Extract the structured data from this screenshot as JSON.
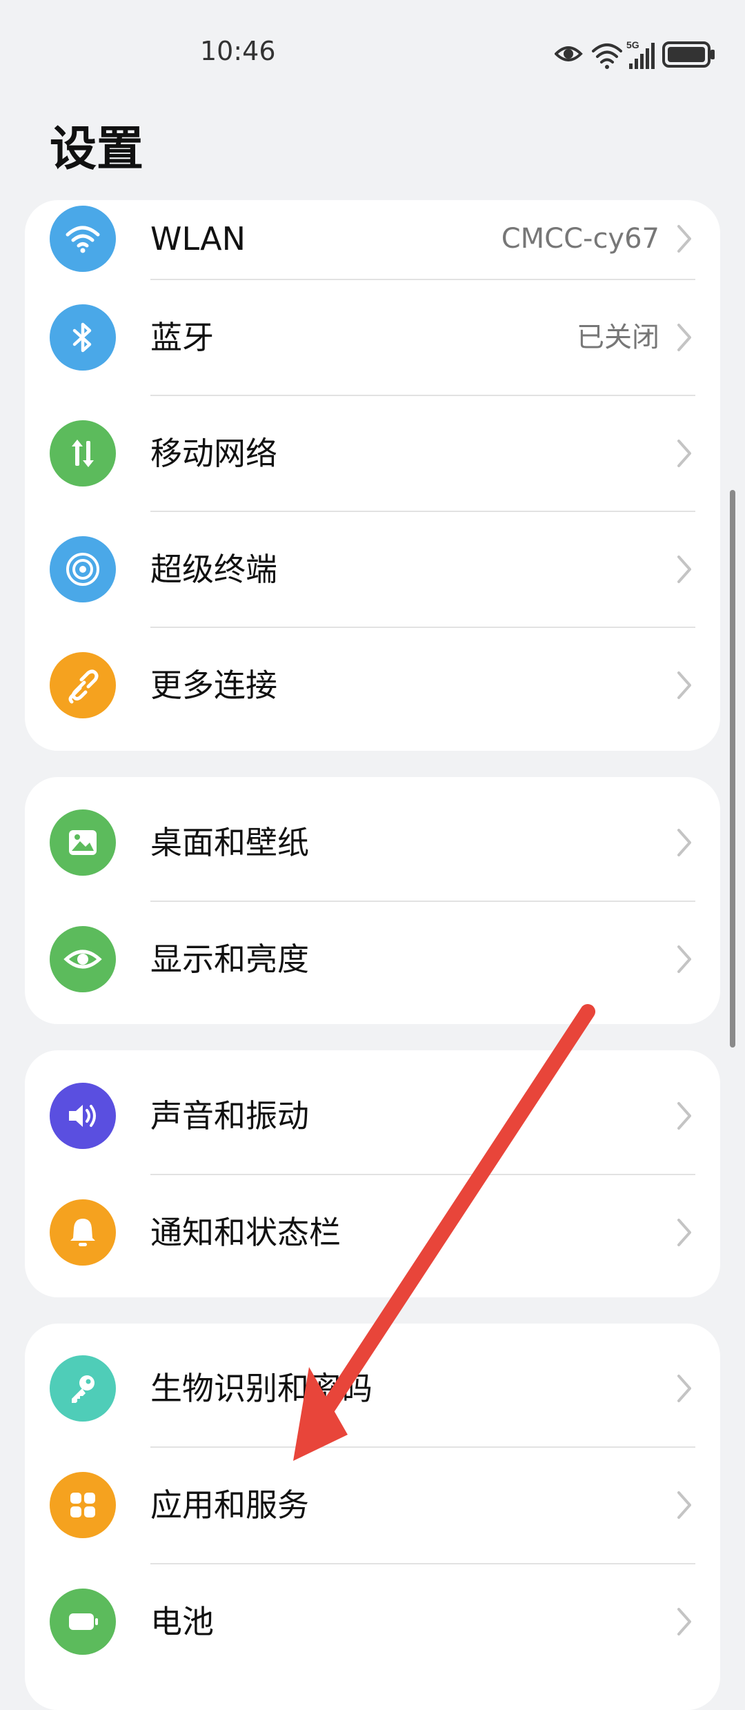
{
  "status_bar": {
    "time": "10:46",
    "network": "5G",
    "icons": [
      "eye-comfort-icon",
      "wifi-icon",
      "signal-icon",
      "battery-icon"
    ]
  },
  "page": {
    "title": "设置"
  },
  "groups": [
    {
      "items": [
        {
          "label": "WLAN",
          "value": "CMCC-cy67",
          "icon": "wifi-icon",
          "color": "#4aa8e8"
        },
        {
          "label": "蓝牙",
          "value": "已关闭",
          "icon": "bluetooth-icon",
          "color": "#4aa8e8"
        },
        {
          "label": "移动网络",
          "value": "",
          "icon": "mobile-data-icon",
          "color": "#5cbb5c"
        },
        {
          "label": "超级终端",
          "value": "",
          "icon": "super-device-icon",
          "color": "#4aa8e8"
        },
        {
          "label": "更多连接",
          "value": "",
          "icon": "link-icon",
          "color": "#f5a21f"
        }
      ]
    },
    {
      "items": [
        {
          "label": "桌面和壁纸",
          "value": "",
          "icon": "wallpaper-icon",
          "color": "#5cbb5c"
        },
        {
          "label": "显示和亮度",
          "value": "",
          "icon": "eye-icon",
          "color": "#5cbb5c"
        }
      ]
    },
    {
      "items": [
        {
          "label": "声音和振动",
          "value": "",
          "icon": "speaker-icon",
          "color": "#5a4fe0"
        },
        {
          "label": "通知和状态栏",
          "value": "",
          "icon": "bell-icon",
          "color": "#f5a21f"
        }
      ]
    },
    {
      "items": [
        {
          "label": "生物识别和密码",
          "value": "",
          "icon": "key-icon",
          "color": "#4fcdb8"
        },
        {
          "label": "应用和服务",
          "value": "",
          "icon": "apps-icon",
          "color": "#f5a21f"
        },
        {
          "label": "电池",
          "value": "",
          "icon": "battery-icon",
          "color": "#5cbb5c"
        }
      ]
    }
  ],
  "annotation": {
    "arrow_color": "#e8453a"
  }
}
